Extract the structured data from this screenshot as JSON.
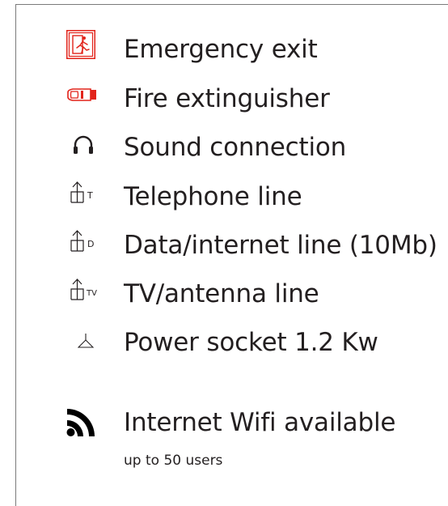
{
  "legend": {
    "items": [
      {
        "label": "Emergency exit",
        "icon": "emergency-exit-icon",
        "color": "#e2231a"
      },
      {
        "label": "Fire extinguisher",
        "icon": "fire-extinguisher-icon",
        "color": "#e2231a"
      },
      {
        "label": "Sound connection",
        "icon": "headphones-icon",
        "color": "#231f20"
      },
      {
        "label": "Telephone line",
        "icon": "telephone-socket-icon",
        "tag": "T",
        "color": "#231f20"
      },
      {
        "label": "Data/internet line (10Mb)",
        "icon": "data-socket-icon",
        "tag": "D",
        "color": "#231f20"
      },
      {
        "label": "TV/antenna line",
        "icon": "tv-socket-icon",
        "tag": "TV",
        "color": "#231f20"
      },
      {
        "label": "Power socket 1.2 Kw",
        "icon": "power-socket-icon",
        "color": "#231f20"
      }
    ],
    "wifi": {
      "label": "Internet Wifi available",
      "sublabel": "up to 50 users",
      "icon": "wifi-icon",
      "color": "#000000"
    }
  }
}
